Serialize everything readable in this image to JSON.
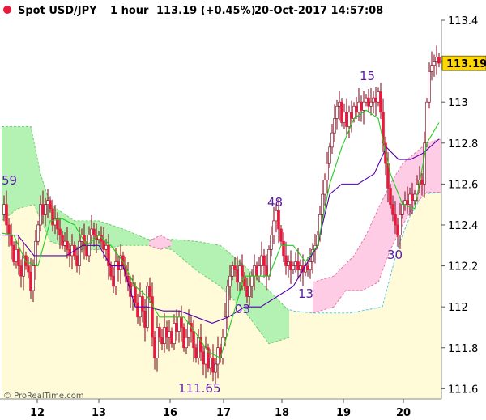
{
  "header": {
    "symbol": "Spot USD/JPY",
    "timeframe": "1 hour",
    "quote": "113.19 (+0.45%)",
    "datetime": "20-Oct-2017 14:57:08",
    "icon": "red-dot-icon"
  },
  "credit": "© ProRealTime.com",
  "colors": {
    "bull": "#ffffff",
    "bear": "#e8193c",
    "wick": "#7a0015",
    "tenkan": "#22cc22",
    "kijun": "#5500aa",
    "kumo_bull": "#b4f2b4",
    "kumo_bear": "#ffcce6",
    "lagging_fill": "#fffbd9",
    "lagging_edge": "#55c8ee",
    "price_label": "#ffd700"
  },
  "chart_data": {
    "type": "candlestick",
    "title": "Spot USD/JPY",
    "xlabel": "",
    "ylabel": "",
    "grid": false,
    "ylim": [
      111.55,
      113.4
    ],
    "yticks": [
      "113.4",
      "113.2",
      "113",
      "112.8",
      "112.6",
      "112.4",
      "112.2",
      "112",
      "111.8",
      "111.6"
    ],
    "xticks": [
      "12",
      "13",
      "16",
      "17",
      "18",
      "19",
      "20"
    ],
    "last_price": "113.19",
    "annotations": [
      {
        "text": "59",
        "x": "Oct 11",
        "y": 112.6
      },
      {
        "text": "48",
        "x": "Oct 17",
        "y": 112.5
      },
      {
        "text": "111.65",
        "x": "Oct 16",
        "y": 111.65
      },
      {
        "text": "03",
        "x": "Oct 17",
        "y": 112.03
      },
      {
        "text": "13",
        "x": "Oct 18",
        "y": 112.13
      },
      {
        "text": "15",
        "x": "Oct 19",
        "y": 113.15
      },
      {
        "text": "30",
        "x": "Oct 20",
        "y": 112.3
      }
    ],
    "price_path": [
      [
        0,
        112.45
      ],
      [
        3,
        112.5
      ],
      [
        6,
        112.4
      ],
      [
        9,
        112.35
      ],
      [
        12,
        112.3
      ],
      [
        15,
        112.22
      ],
      [
        18,
        112.28
      ],
      [
        21,
        112.2
      ],
      [
        24,
        112.15
      ],
      [
        27,
        112.25
      ],
      [
        30,
        112.2
      ],
      [
        33,
        112.17
      ],
      [
        36,
        112.08
      ],
      [
        39,
        112.2
      ],
      [
        42,
        112.32
      ],
      [
        45,
        112.4
      ],
      [
        48,
        112.5
      ],
      [
        51,
        112.45
      ],
      [
        54,
        112.5
      ],
      [
        57,
        112.52
      ],
      [
        60,
        112.48
      ],
      [
        63,
        112.4
      ],
      [
        66,
        112.43
      ],
      [
        69,
        112.38
      ],
      [
        72,
        112.35
      ],
      [
        75,
        112.3
      ],
      [
        78,
        112.32
      ],
      [
        81,
        112.28
      ],
      [
        84,
        112.25
      ],
      [
        87,
        112.3
      ],
      [
        90,
        112.25
      ],
      [
        93,
        112.2
      ],
      [
        96,
        112.32
      ],
      [
        99,
        112.35
      ],
      [
        102,
        112.3
      ],
      [
        105,
        112.25
      ],
      [
        108,
        112.35
      ],
      [
        111,
        112.38
      ],
      [
        114,
        112.35
      ],
      [
        117,
        112.33
      ],
      [
        120,
        112.35
      ],
      [
        123,
        112.32
      ],
      [
        126,
        112.28
      ],
      [
        129,
        112.3
      ],
      [
        132,
        112.2
      ],
      [
        135,
        112.15
      ],
      [
        138,
        112.1
      ],
      [
        141,
        112.22
      ],
      [
        144,
        112.18
      ],
      [
        147,
        112.25
      ],
      [
        150,
        112.2
      ],
      [
        153,
        112.15
      ],
      [
        156,
        112.12
      ],
      [
        159,
        112.05
      ],
      [
        162,
        112.1
      ],
      [
        165,
        112.02
      ],
      [
        168,
        111.95
      ],
      [
        171,
        112.05
      ],
      [
        174,
        111.98
      ],
      [
        177,
        111.9
      ],
      [
        180,
        112.1
      ],
      [
        183,
        112.05
      ],
      [
        186,
        111.85
      ],
      [
        189,
        111.75
      ],
      [
        192,
        111.9
      ],
      [
        195,
        111.85
      ],
      [
        198,
        111.82
      ],
      [
        201,
        111.9
      ],
      [
        204,
        111.85
      ],
      [
        207,
        111.88
      ],
      [
        210,
        111.82
      ],
      [
        213,
        111.92
      ],
      [
        216,
        111.88
      ],
      [
        219,
        111.95
      ],
      [
        222,
        111.9
      ],
      [
        225,
        111.8
      ],
      [
        228,
        111.85
      ],
      [
        231,
        111.92
      ],
      [
        234,
        111.88
      ],
      [
        237,
        111.8
      ],
      [
        240,
        111.75
      ],
      [
        243,
        111.85
      ],
      [
        246,
        111.78
      ],
      [
        249,
        111.72
      ],
      [
        252,
        111.8
      ],
      [
        255,
        111.7
      ],
      [
        258,
        111.75
      ],
      [
        261,
        111.68
      ],
      [
        264,
        111.72
      ],
      [
        267,
        111.8
      ],
      [
        270,
        111.75
      ],
      [
        273,
        111.85
      ],
      [
        276,
        111.95
      ],
      [
        279,
        112.1
      ],
      [
        282,
        112.15
      ],
      [
        285,
        112.2
      ],
      [
        288,
        112.18
      ],
      [
        291,
        112.12
      ],
      [
        294,
        112.2
      ],
      [
        297,
        112.15
      ],
      [
        300,
        112.1
      ],
      [
        303,
        112.05
      ],
      [
        306,
        112.1
      ],
      [
        309,
        112.15
      ],
      [
        312,
        112.2
      ],
      [
        315,
        112.15
      ],
      [
        318,
        112.2
      ],
      [
        321,
        112.25
      ],
      [
        324,
        112.2
      ],
      [
        327,
        112.15
      ],
      [
        330,
        112.28
      ],
      [
        333,
        112.35
      ],
      [
        336,
        112.42
      ],
      [
        339,
        112.47
      ],
      [
        342,
        112.38
      ],
      [
        345,
        112.32
      ],
      [
        348,
        112.25
      ],
      [
        351,
        112.2
      ],
      [
        354,
        112.22
      ],
      [
        357,
        112.18
      ],
      [
        360,
        112.2
      ],
      [
        363,
        112.22
      ],
      [
        366,
        112.18
      ],
      [
        369,
        112.2
      ],
      [
        372,
        112.17
      ],
      [
        375,
        112.2
      ],
      [
        378,
        112.18
      ],
      [
        381,
        112.22
      ],
      [
        384,
        112.28
      ],
      [
        387,
        112.3
      ],
      [
        390,
        112.35
      ],
      [
        393,
        112.45
      ],
      [
        396,
        112.55
      ],
      [
        399,
        112.62
      ],
      [
        402,
        112.7
      ],
      [
        405,
        112.78
      ],
      [
        408,
        112.85
      ],
      [
        411,
        112.92
      ],
      [
        414,
        112.98
      ],
      [
        417,
        113.0
      ],
      [
        420,
        112.9
      ],
      [
        423,
        112.95
      ],
      [
        426,
        112.88
      ],
      [
        429,
        112.95
      ],
      [
        432,
        112.92
      ],
      [
        435,
        112.98
      ],
      [
        438,
        112.95
      ],
      [
        441,
        113.0
      ],
      [
        444,
        112.96
      ],
      [
        447,
        113.0
      ],
      [
        450,
        113.02
      ],
      [
        453,
        112.98
      ],
      [
        456,
        113.0
      ],
      [
        459,
        113.02
      ],
      [
        462,
        113.0
      ],
      [
        465,
        113.05
      ],
      [
        468,
        112.95
      ],
      [
        471,
        112.8
      ],
      [
        474,
        112.7
      ],
      [
        477,
        112.58
      ],
      [
        480,
        112.5
      ],
      [
        483,
        112.45
      ],
      [
        486,
        112.4
      ],
      [
        489,
        112.35
      ],
      [
        492,
        112.45
      ],
      [
        495,
        112.5
      ],
      [
        498,
        112.52
      ],
      [
        501,
        112.5
      ],
      [
        504,
        112.55
      ],
      [
        507,
        112.52
      ],
      [
        510,
        112.55
      ],
      [
        513,
        112.6
      ],
      [
        516,
        112.62
      ],
      [
        519,
        112.6
      ],
      [
        522,
        112.8
      ],
      [
        525,
        113.0
      ],
      [
        528,
        113.15
      ],
      [
        531,
        113.18
      ],
      [
        534,
        113.2
      ],
      [
        537,
        113.22
      ],
      [
        540,
        113.19
      ]
    ],
    "tenkan_line": [
      [
        0,
        112.36
      ],
      [
        15,
        112.35
      ],
      [
        30,
        112.22
      ],
      [
        45,
        112.2
      ],
      [
        60,
        112.42
      ],
      [
        75,
        112.43
      ],
      [
        90,
        112.4
      ],
      [
        105,
        112.3
      ],
      [
        120,
        112.35
      ],
      [
        135,
        112.3
      ],
      [
        150,
        112.22
      ],
      [
        165,
        112.1
      ],
      [
        180,
        112.05
      ],
      [
        195,
        111.95
      ],
      [
        210,
        111.95
      ],
      [
        225,
        111.95
      ],
      [
        240,
        111.87
      ],
      [
        255,
        111.78
      ],
      [
        270,
        111.75
      ],
      [
        285,
        111.95
      ],
      [
        300,
        112.15
      ],
      [
        315,
        112.15
      ],
      [
        330,
        112.15
      ],
      [
        345,
        112.3
      ],
      [
        360,
        112.3
      ],
      [
        375,
        112.22
      ],
      [
        390,
        112.3
      ],
      [
        405,
        112.6
      ],
      [
        420,
        112.78
      ],
      [
        435,
        112.92
      ],
      [
        450,
        112.96
      ],
      [
        465,
        112.92
      ],
      [
        480,
        112.65
      ],
      [
        495,
        112.5
      ],
      [
        510,
        112.48
      ],
      [
        525,
        112.8
      ],
      [
        540,
        112.9
      ]
    ],
    "kijun_line": [
      [
        0,
        112.35
      ],
      [
        20,
        112.35
      ],
      [
        40,
        112.25
      ],
      [
        60,
        112.25
      ],
      [
        80,
        112.25
      ],
      [
        100,
        112.3
      ],
      [
        120,
        112.3
      ],
      [
        135,
        112.2
      ],
      [
        150,
        112.2
      ],
      [
        165,
        112.0
      ],
      [
        180,
        112.0
      ],
      [
        200,
        111.98
      ],
      [
        220,
        111.98
      ],
      [
        240,
        111.95
      ],
      [
        260,
        111.92
      ],
      [
        280,
        111.95
      ],
      [
        300,
        112.0
      ],
      [
        320,
        112.0
      ],
      [
        340,
        112.05
      ],
      [
        360,
        112.1
      ],
      [
        375,
        112.2
      ],
      [
        390,
        112.3
      ],
      [
        405,
        112.55
      ],
      [
        420,
        112.6
      ],
      [
        440,
        112.6
      ],
      [
        460,
        112.65
      ],
      [
        475,
        112.78
      ],
      [
        490,
        112.72
      ],
      [
        505,
        112.72
      ],
      [
        520,
        112.75
      ],
      [
        540,
        112.82
      ]
    ],
    "kumo": [
      {
        "color": "bull",
        "upper": [
          [
            0,
            112.88
          ],
          [
            36,
            112.88
          ],
          [
            48,
            112.65
          ],
          [
            60,
            112.5
          ],
          [
            90,
            112.42
          ],
          [
            120,
            112.42
          ],
          [
            150,
            112.38
          ],
          [
            180,
            112.33
          ],
          [
            210,
            112.33
          ],
          [
            240,
            112.32
          ],
          [
            270,
            112.3
          ],
          [
            300,
            112.2
          ],
          [
            330,
            112.08
          ],
          [
            355,
            111.98
          ]
        ],
        "lower": [
          [
            0,
            112.42
          ],
          [
            20,
            112.48
          ],
          [
            40,
            112.5
          ],
          [
            60,
            112.32
          ],
          [
            90,
            112.28
          ],
          [
            120,
            112.28
          ],
          [
            150,
            112.3
          ],
          [
            180,
            112.3
          ],
          [
            210,
            112.28
          ],
          [
            240,
            112.18
          ],
          [
            270,
            112.1
          ],
          [
            300,
            111.98
          ],
          [
            330,
            111.82
          ],
          [
            355,
            111.85
          ]
        ]
      },
      {
        "color": "bear",
        "upper": [
          [
            182,
            112.32
          ],
          [
            196,
            112.35
          ],
          [
            210,
            112.32
          ]
        ],
        "lower": [
          [
            182,
            112.3
          ],
          [
            196,
            112.28
          ],
          [
            210,
            112.3
          ]
        ]
      },
      {
        "color": "bear",
        "upper": [
          [
            384,
            112.12
          ],
          [
            410,
            112.15
          ],
          [
            435,
            112.25
          ],
          [
            450,
            112.35
          ],
          [
            465,
            112.48
          ],
          [
            480,
            112.6
          ],
          [
            495,
            112.7
          ],
          [
            510,
            112.75
          ],
          [
            525,
            112.8
          ],
          [
            543,
            112.82
          ]
        ],
        "lower": [
          [
            384,
            111.97
          ],
          [
            410,
            112.0
          ],
          [
            425,
            112.08
          ],
          [
            445,
            112.08
          ],
          [
            465,
            112.12
          ],
          [
            480,
            112.28
          ],
          [
            495,
            112.4
          ],
          [
            510,
            112.5
          ],
          [
            525,
            112.56
          ],
          [
            543,
            112.56
          ]
        ]
      }
    ]
  }
}
